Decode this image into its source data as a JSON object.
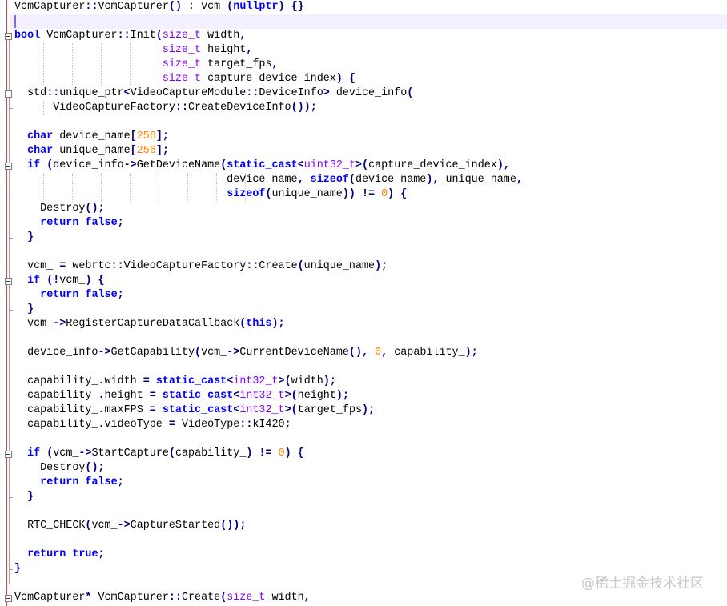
{
  "editor": {
    "lines": [
      "VcmCapturer::VcmCapturer() : vcm_(nullptr) {}",
      "",
      "bool VcmCapturer::Init(size_t width,",
      "                       size_t height,",
      "                       size_t target_fps,",
      "                       size_t capture_device_index) {",
      "  std::unique_ptr<VideoCaptureModule::DeviceInfo> device_info(",
      "      VideoCaptureFactory::CreateDeviceInfo());",
      "",
      "  char device_name[256];",
      "  char unique_name[256];",
      "  if (device_info->GetDeviceName(static_cast<uint32_t>(capture_device_index),",
      "                                 device_name, sizeof(device_name), unique_name,",
      "                                 sizeof(unique_name)) != 0) {",
      "    Destroy();",
      "    return false;",
      "  }",
      "",
      "  vcm_ = webrtc::VideoCaptureFactory::Create(unique_name);",
      "  if (!vcm_) {",
      "    return false;",
      "  }",
      "  vcm_->RegisterCaptureDataCallback(this);",
      "",
      "  device_info->GetCapability(vcm_->CurrentDeviceName(), 0, capability_);",
      "",
      "  capability_.width = static_cast<int32_t>(width);",
      "  capability_.height = static_cast<int32_t>(height);",
      "  capability_.maxFPS = static_cast<int32_t>(target_fps);",
      "  capability_.videoType = VideoType::kI420;",
      "",
      "  if (vcm_->StartCapture(capability_) != 0) {",
      "    Destroy();",
      "    return false;",
      "  }",
      "",
      "  RTC_CHECK(vcm_->CaptureStarted());",
      "",
      "  return true;",
      "}",
      "",
      "VcmCapturer* VcmCapturer::Create(size_t width,"
    ]
  },
  "watermark": "@稀土掘金技术社区",
  "colors": {
    "keyword": "#0000ff",
    "type": "#8000ff",
    "number": "#ff8000",
    "operator": "#000080",
    "gutter": "#e04040"
  }
}
